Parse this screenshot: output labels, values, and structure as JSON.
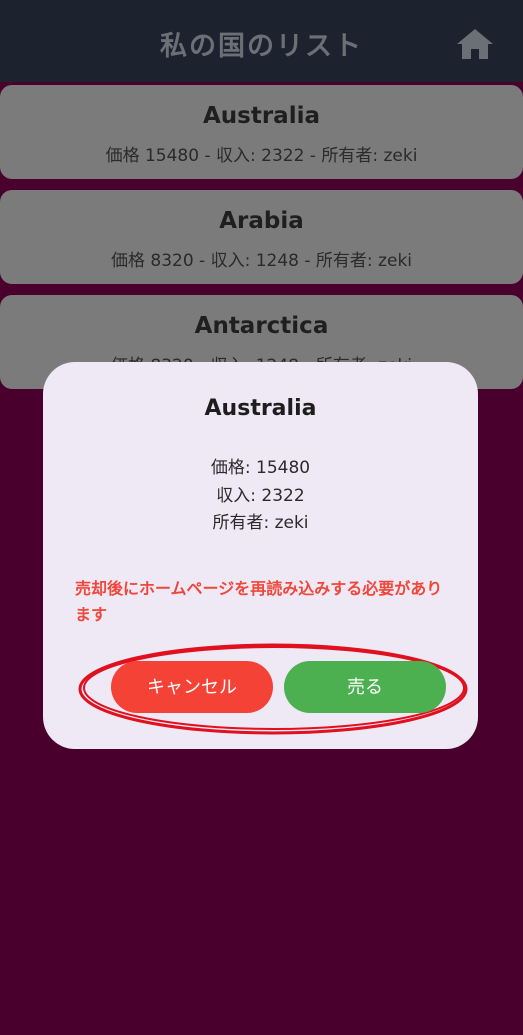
{
  "app_bar": {
    "title": "私の国のリスト",
    "home_icon": "home-icon"
  },
  "countries": [
    {
      "name": "Australia",
      "details": "価格 15480 - 収入: 2322 - 所有者: zeki"
    },
    {
      "name": "Arabia",
      "details": "価格 8320 - 収入: 1248 - 所有者: zeki"
    },
    {
      "name": "Antarctica",
      "details": "価格 8320 - 収入: 1248 - 所有者: zeki"
    }
  ],
  "dialog": {
    "title": "Australia",
    "price": "価格: 15480",
    "income": "収入: 2322",
    "owner": "所有者: zeki",
    "warning": "売却後にホームページを再読み込みする必要があります",
    "cancel_label": "キャンセル",
    "sell_label": "売る"
  },
  "colors": {
    "background": "#4a002d",
    "app_bar": "#1c222e",
    "card": "#7b7b7b",
    "dialog": "#efe8f5",
    "warning": "#f0473b",
    "cancel": "#f44336",
    "sell": "#4caf50",
    "annotation": "#e0101f"
  }
}
